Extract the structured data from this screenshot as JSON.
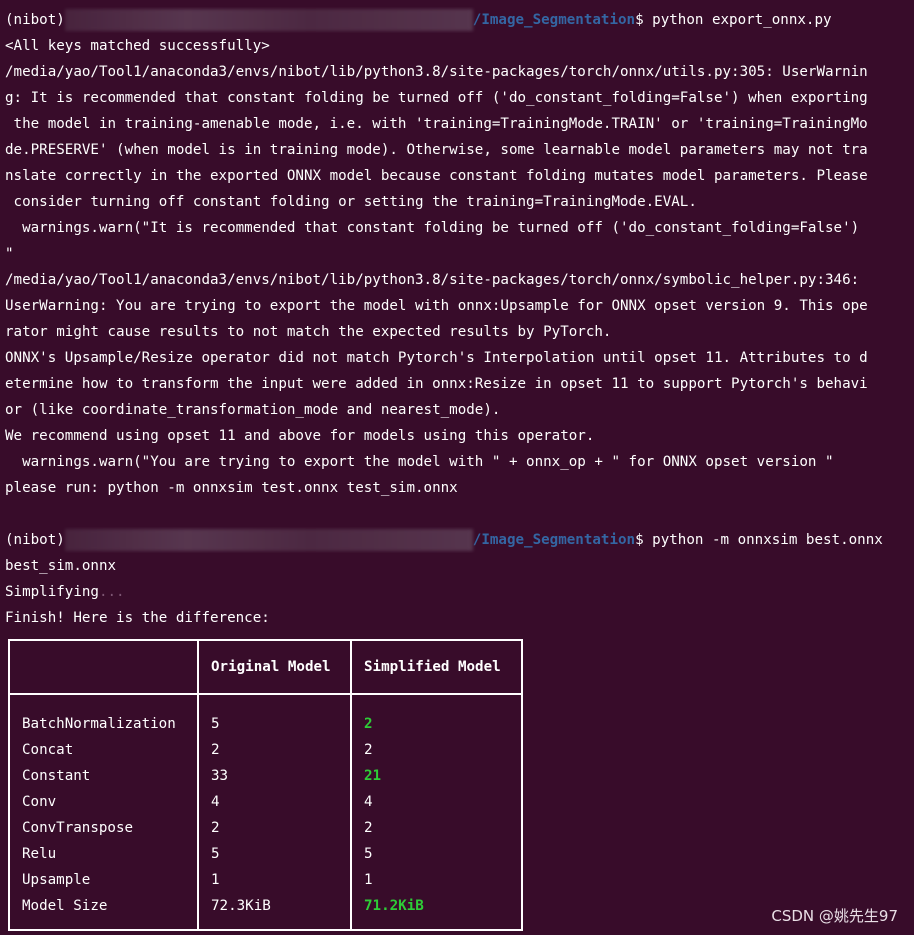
{
  "terminal": {
    "prompt1": {
      "user_prefix": "(nibot)",
      "path_suffix": "/Image_Segmentation",
      "dollar": "$",
      "command": " python export_onnx.py"
    },
    "output_lines": [
      "<All keys matched successfully>",
      "/media/yao/Tool1/anaconda3/envs/nibot/lib/python3.8/site-packages/torch/onnx/utils.py:305: UserWarnin",
      "g: It is recommended that constant folding be turned off ('do_constant_folding=False') when exporting",
      " the model in training-amenable mode, i.e. with 'training=TrainingMode.TRAIN' or 'training=TrainingMo",
      "de.PRESERVE' (when model is in training mode). Otherwise, some learnable model parameters may not tra",
      "nslate correctly in the exported ONNX model because constant folding mutates model parameters. Please",
      " consider turning off constant folding or setting the training=TrainingMode.EVAL.",
      "  warnings.warn(\"It is recommended that constant folding be turned off ('do_constant_folding=False')",
      "\"",
      "/media/yao/Tool1/anaconda3/envs/nibot/lib/python3.8/site-packages/torch/onnx/symbolic_helper.py:346:",
      "UserWarning: You are trying to export the model with onnx:Upsample for ONNX opset version 9. This ope",
      "rator might cause results to not match the expected results by PyTorch.",
      "ONNX's Upsample/Resize operator did not match Pytorch's Interpolation until opset 11. Attributes to d",
      "etermine how to transform the input were added in onnx:Resize in opset 11 to support Pytorch's behavi",
      "or (like coordinate_transformation_mode and nearest_mode).",
      "We recommend using opset 11 and above for models using this operator.",
      "  warnings.warn(\"You are trying to export the model with \" + onnx_op + \" for ONNX opset version \"",
      "please run: python -m onnxsim test.onnx test_sim.onnx"
    ],
    "prompt2": {
      "user_prefix": "(nibot)",
      "path_suffix": "/Image_Segmentation",
      "dollar": "$",
      "command": " python -m onnxsim best.onnx"
    },
    "after_lines": {
      "cont": "best_sim.onnx",
      "simplifying": "Simplifying",
      "dots": "...",
      "finish": "Finish! Here is the difference:"
    }
  },
  "table": {
    "headers": [
      "",
      "Original Model",
      "Simplified Model"
    ],
    "rows": [
      {
        "name": "BatchNormalization",
        "original": "5",
        "simplified": "2",
        "changed": true
      },
      {
        "name": "Concat",
        "original": "2",
        "simplified": "2",
        "changed": false
      },
      {
        "name": "Constant",
        "original": "33",
        "simplified": "21",
        "changed": true
      },
      {
        "name": "Conv",
        "original": "4",
        "simplified": "4",
        "changed": false
      },
      {
        "name": "ConvTranspose",
        "original": "2",
        "simplified": "2",
        "changed": false
      },
      {
        "name": "Relu",
        "original": "5",
        "simplified": "5",
        "changed": false
      },
      {
        "name": "Upsample",
        "original": "1",
        "simplified": "1",
        "changed": false
      },
      {
        "name": "Model Size",
        "original": "72.3KiB",
        "simplified": "71.2KiB",
        "changed": true
      }
    ],
    "highlight_color": "#2ecc37"
  },
  "watermark": "CSDN @姚先生97",
  "colors": {
    "background": "#380c2a",
    "path": "#3466a3",
    "text": "#ffffff"
  }
}
